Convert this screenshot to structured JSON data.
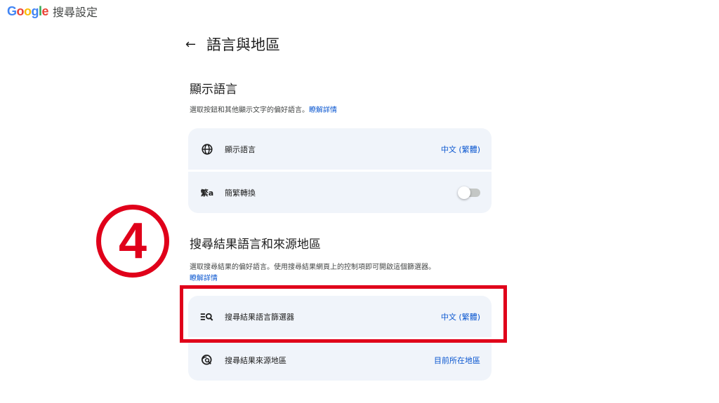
{
  "header": {
    "logo_letters": [
      {
        "ch": "G",
        "color": "#4285f4"
      },
      {
        "ch": "o",
        "color": "#ea4335"
      },
      {
        "ch": "o",
        "color": "#fbbc05"
      },
      {
        "ch": "g",
        "color": "#4285f4"
      },
      {
        "ch": "l",
        "color": "#34a853"
      },
      {
        "ch": "e",
        "color": "#ea4335"
      }
    ],
    "title": "搜尋設定"
  },
  "page": {
    "back_icon": "arrow-left-icon",
    "title": "語言與地區"
  },
  "display_language_section": {
    "heading": "顯示語言",
    "description": "選取按鈕和其他顯示文字的偏好語言。",
    "learn_more": "瞭解詳情",
    "rows": [
      {
        "icon": "globe-icon",
        "label": "顯示語言",
        "value": "中文 (繁體)"
      },
      {
        "icon": "translate-icon",
        "icon_text": "繁a",
        "label": "簡繁轉換",
        "toggle_on": false
      }
    ]
  },
  "search_results_section": {
    "heading": "搜尋結果語言和來源地區",
    "description": "選取搜尋結果的偏好語言。使用搜尋結果網頁上的控制項即可開啟這個篩選器。",
    "learn_more": "瞭解詳情",
    "rows": [
      {
        "icon": "filter-search-icon",
        "label": "搜尋結果語言篩選器",
        "value": "中文 (繁體)"
      },
      {
        "icon": "region-search-icon",
        "label": "搜尋結果來源地區",
        "value": "目前所在地區"
      }
    ]
  },
  "annotation": {
    "step_marker": "4",
    "highlight_color": "#e0001a"
  }
}
